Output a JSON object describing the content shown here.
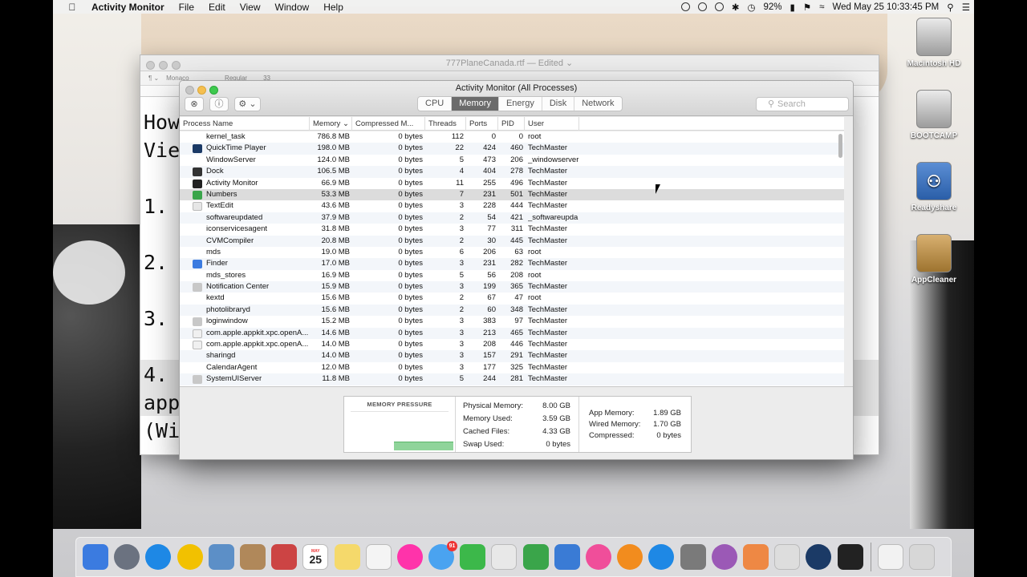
{
  "menubar": {
    "app_name": "Activity Monitor",
    "items": [
      "File",
      "Edit",
      "View",
      "Window",
      "Help"
    ],
    "battery": "92%",
    "datetime": "Wed May 25  10:33:45 PM"
  },
  "desktop": {
    "icons": [
      {
        "label": "Macintosh HD",
        "icon": "hard-drive-icon"
      },
      {
        "label": "BOOTCAMP",
        "icon": "hard-drive-icon"
      },
      {
        "label": "Readyshare",
        "icon": "network-drive-icon"
      },
      {
        "label": "AppCleaner",
        "icon": "trash-app-icon"
      }
    ]
  },
  "textedit": {
    "title": "777PlaneCanada.rtf — Edited ⌄",
    "font": "Monaco",
    "style": "Regular",
    "size": "33",
    "lines": [
      "How",
      "Vie",
      "",
      "1.",
      "",
      "2.",
      "",
      "3.",
      "",
      "4.",
      "app",
      "(Wi"
    ]
  },
  "activity_monitor": {
    "title": "Activity Monitor (All Processes)",
    "tabs": [
      "CPU",
      "Memory",
      "Energy",
      "Disk",
      "Network"
    ],
    "active_tab": "Memory",
    "search_placeholder": "Search",
    "columns": {
      "name": "Process Name",
      "memory": "Memory ⌄",
      "compressed": "Compressed M...",
      "threads": "Threads",
      "ports": "Ports",
      "pid": "PID",
      "user": "User"
    },
    "rows": [
      {
        "name": "kernel_task",
        "memory": "786.8 MB",
        "compressed": "0 bytes",
        "threads": "112",
        "ports": "0",
        "pid": "0",
        "user": "root",
        "icon": "none"
      },
      {
        "name": "QuickTime Player",
        "memory": "198.0 MB",
        "compressed": "0 bytes",
        "threads": "22",
        "ports": "424",
        "pid": "460",
        "user": "TechMaster",
        "icon": "quicktime-icon"
      },
      {
        "name": "WindowServer",
        "memory": "124.0 MB",
        "compressed": "0 bytes",
        "threads": "5",
        "ports": "473",
        "pid": "206",
        "user": "_windowserver",
        "icon": "none"
      },
      {
        "name": "Dock",
        "memory": "106.5 MB",
        "compressed": "0 bytes",
        "threads": "4",
        "ports": "404",
        "pid": "278",
        "user": "TechMaster",
        "icon": "dock-icon"
      },
      {
        "name": "Activity Monitor",
        "memory": "66.9 MB",
        "compressed": "0 bytes",
        "threads": "11",
        "ports": "255",
        "pid": "496",
        "user": "TechMaster",
        "icon": "activity-monitor-icon"
      },
      {
        "name": "Numbers",
        "memory": "53.3 MB",
        "compressed": "0 bytes",
        "threads": "7",
        "ports": "231",
        "pid": "501",
        "user": "TechMaster",
        "icon": "numbers-icon"
      },
      {
        "name": "TextEdit",
        "memory": "43.6 MB",
        "compressed": "0 bytes",
        "threads": "3",
        "ports": "228",
        "pid": "444",
        "user": "TechMaster",
        "icon": "textedit-icon"
      },
      {
        "name": "softwareupdated",
        "memory": "37.9 MB",
        "compressed": "0 bytes",
        "threads": "2",
        "ports": "54",
        "pid": "421",
        "user": "_softwareupda",
        "icon": "none"
      },
      {
        "name": "iconservicesagent",
        "memory": "31.8 MB",
        "compressed": "0 bytes",
        "threads": "3",
        "ports": "77",
        "pid": "311",
        "user": "TechMaster",
        "icon": "none"
      },
      {
        "name": "CVMCompiler",
        "memory": "20.8 MB",
        "compressed": "0 bytes",
        "threads": "2",
        "ports": "30",
        "pid": "445",
        "user": "TechMaster",
        "icon": "none"
      },
      {
        "name": "mds",
        "memory": "19.0 MB",
        "compressed": "0 bytes",
        "threads": "6",
        "ports": "206",
        "pid": "63",
        "user": "root",
        "icon": "none"
      },
      {
        "name": "Finder",
        "memory": "17.0 MB",
        "compressed": "0 bytes",
        "threads": "3",
        "ports": "231",
        "pid": "282",
        "user": "TechMaster",
        "icon": "finder-icon"
      },
      {
        "name": "mds_stores",
        "memory": "16.9 MB",
        "compressed": "0 bytes",
        "threads": "5",
        "ports": "56",
        "pid": "208",
        "user": "root",
        "icon": "none"
      },
      {
        "name": "Notification Center",
        "memory": "15.9 MB",
        "compressed": "0 bytes",
        "threads": "3",
        "ports": "199",
        "pid": "365",
        "user": "TechMaster",
        "icon": "generic-app-icon"
      },
      {
        "name": "kextd",
        "memory": "15.6 MB",
        "compressed": "0 bytes",
        "threads": "2",
        "ports": "67",
        "pid": "47",
        "user": "root",
        "icon": "none"
      },
      {
        "name": "photolibraryd",
        "memory": "15.6 MB",
        "compressed": "0 bytes",
        "threads": "2",
        "ports": "60",
        "pid": "348",
        "user": "TechMaster",
        "icon": "none"
      },
      {
        "name": "loginwindow",
        "memory": "15.2 MB",
        "compressed": "0 bytes",
        "threads": "3",
        "ports": "383",
        "pid": "97",
        "user": "TechMaster",
        "icon": "generic-app-icon"
      },
      {
        "name": "com.apple.appkit.xpc.openA...",
        "memory": "14.6 MB",
        "compressed": "0 bytes",
        "threads": "3",
        "ports": "213",
        "pid": "465",
        "user": "TechMaster",
        "icon": "shield-icon"
      },
      {
        "name": "com.apple.appkit.xpc.openA...",
        "memory": "14.0 MB",
        "compressed": "0 bytes",
        "threads": "3",
        "ports": "208",
        "pid": "446",
        "user": "TechMaster",
        "icon": "shield-icon"
      },
      {
        "name": "sharingd",
        "memory": "14.0 MB",
        "compressed": "0 bytes",
        "threads": "3",
        "ports": "157",
        "pid": "291",
        "user": "TechMaster",
        "icon": "none"
      },
      {
        "name": "CalendarAgent",
        "memory": "12.0 MB",
        "compressed": "0 bytes",
        "threads": "3",
        "ports": "177",
        "pid": "325",
        "user": "TechMaster",
        "icon": "none"
      },
      {
        "name": "SystemUIServer",
        "memory": "11.8 MB",
        "compressed": "0 bytes",
        "threads": "5",
        "ports": "244",
        "pid": "281",
        "user": "TechMaster",
        "icon": "generic-app-icon"
      }
    ],
    "selected_row": 5,
    "footer": {
      "pressure_label": "MEMORY PRESSURE",
      "physical_memory_label": "Physical Memory:",
      "physical_memory": "8.00 GB",
      "memory_used_label": "Memory Used:",
      "memory_used": "3.59 GB",
      "cached_files_label": "Cached Files:",
      "cached_files": "4.33 GB",
      "swap_used_label": "Swap Used:",
      "swap_used": "0 bytes",
      "app_memory_label": "App Memory:",
      "app_memory": "1.89 GB",
      "wired_memory_label": "Wired Memory:",
      "wired_memory": "1.70 GB",
      "compressed_label": "Compressed:",
      "compressed": "0 bytes"
    }
  },
  "dock": {
    "calendar_month": "MAY",
    "calendar_day": "25",
    "messages_badge": "91",
    "apps": [
      "finder-icon",
      "launchpad-icon",
      "safari-icon",
      "chrome-icon",
      "preview-icon",
      "contacts-icon",
      "photo-booth-icon",
      "calendar-icon",
      "notes-icon",
      "reminders-icon",
      "photos-icon",
      "messages-icon",
      "facetime-icon",
      "textedit-icon",
      "numbers-icon",
      "keynote-icon",
      "itunes-icon",
      "ibooks-icon",
      "app-store-icon",
      "system-preferences-icon",
      "purple-app-icon",
      "microsoft-office-icon",
      "script-editor-icon",
      "quicktime-icon",
      "activity-monitor-icon"
    ]
  }
}
